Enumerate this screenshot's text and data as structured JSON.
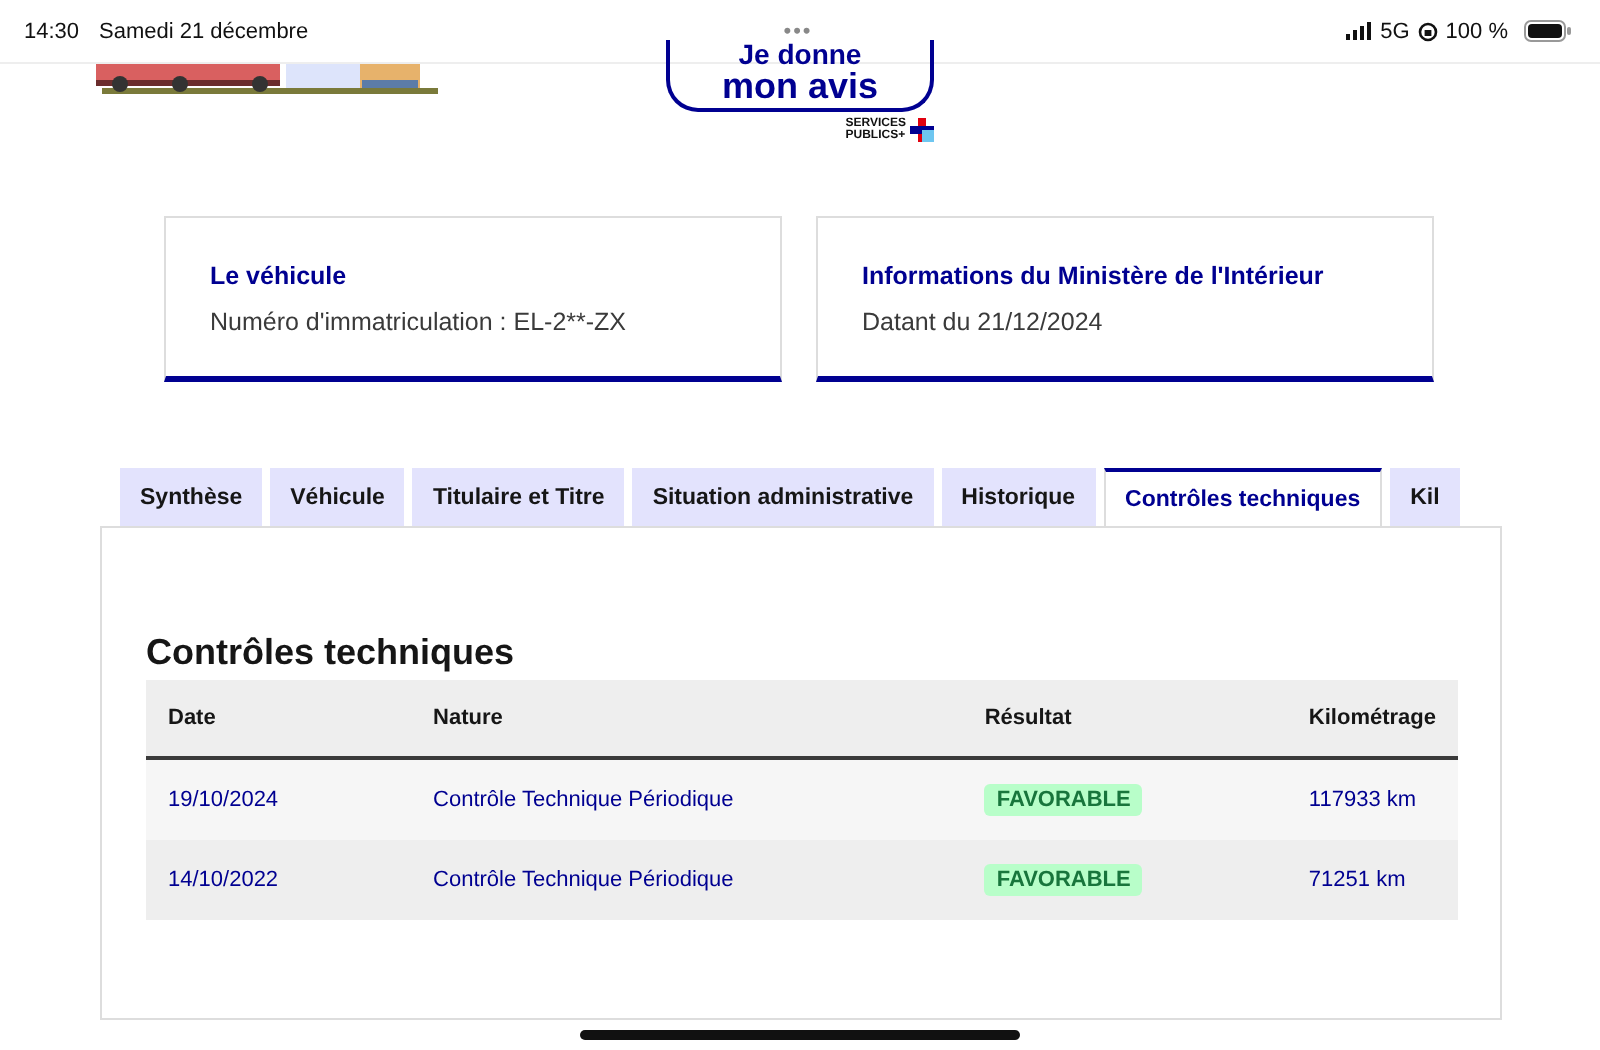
{
  "status_bar": {
    "time": "14:30",
    "date": "Samedi 21 décembre",
    "dots": "•••",
    "network": "5G",
    "battery": "100 %"
  },
  "banner": {
    "button_line_1": "Je donne",
    "button_line_2": "mon avis",
    "logo_line_1": "SERVICES",
    "logo_line_2": "PUBLICS+"
  },
  "cards": [
    {
      "title": "Le véhicule",
      "text": "Numéro d'immatriculation : EL-2**-ZX"
    },
    {
      "title": "Informations du Ministère de l'Intérieur",
      "text": "Datant du 21/12/2024"
    }
  ],
  "tabs": [
    {
      "label": "Synthèse",
      "selected": false
    },
    {
      "label": "Véhicule",
      "selected": false
    },
    {
      "label": "Titulaire et Titre",
      "selected": false
    },
    {
      "label": "Situation administrative",
      "selected": false
    },
    {
      "label": "Historique",
      "selected": false
    },
    {
      "label": "Contrôles techniques",
      "selected": true
    },
    {
      "label": "Kil",
      "selected": false
    }
  ],
  "section": {
    "title": "Contrôles techniques"
  },
  "table": {
    "columns": [
      "Date",
      "Nature",
      "Résultat",
      "Kilométrage"
    ],
    "rows": [
      {
        "date": "19/10/2024",
        "nature": "Contrôle Technique Périodique",
        "result": "FAVORABLE",
        "mileage": "117933 km"
      },
      {
        "date": "14/10/2022",
        "nature": "Contrôle Technique Périodique",
        "result": "FAVORABLE",
        "mileage": "71251 km"
      }
    ]
  }
}
